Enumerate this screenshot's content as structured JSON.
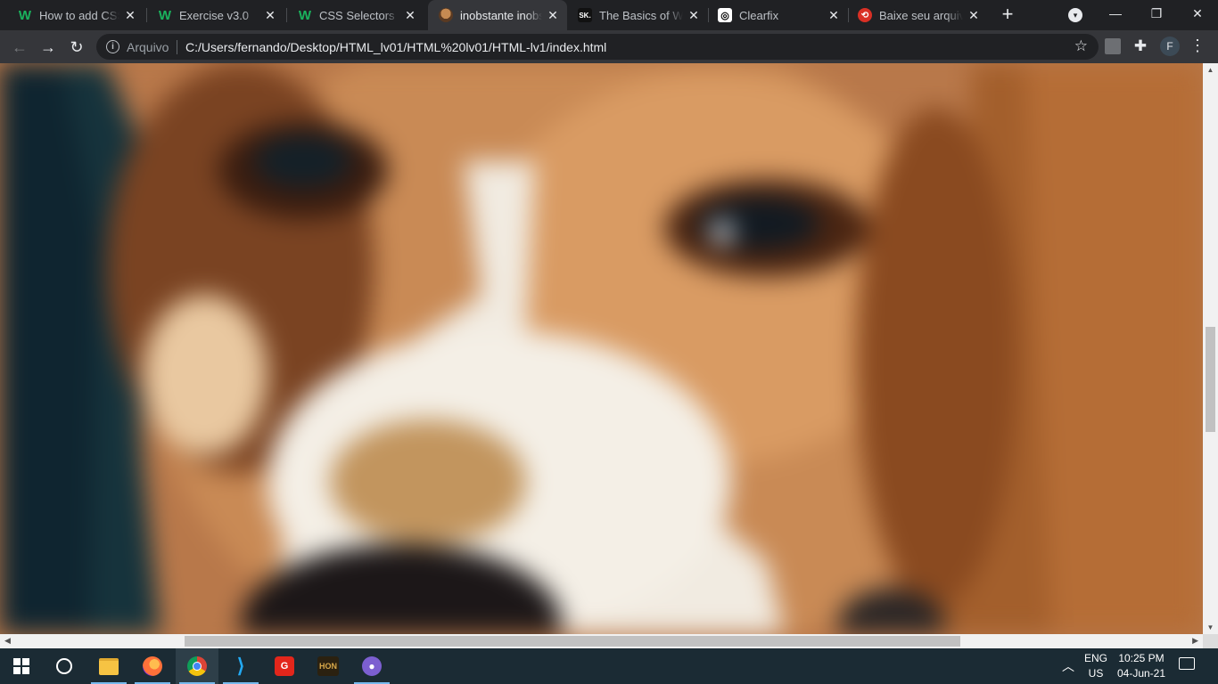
{
  "browser": {
    "tabs": [
      {
        "title": "How to add CSS",
        "favicon": "w3-icon",
        "glyph": "W",
        "active": false
      },
      {
        "title": "Exercise v3.0",
        "favicon": "w3-icon",
        "glyph": "W",
        "active": false
      },
      {
        "title": "CSS Selectors",
        "favicon": "w3-icon",
        "glyph": "W",
        "active": false
      },
      {
        "title": "inobstante inobstante",
        "favicon": "dog-photo-icon",
        "glyph": "",
        "active": true
      },
      {
        "title": "The Basics of Web",
        "favicon": "sk-icon",
        "glyph": "SK.",
        "active": false
      },
      {
        "title": "Clearfix",
        "favicon": "clearfix-icon",
        "glyph": "◎",
        "active": false
      },
      {
        "title": "Baixe seu arquivo",
        "favicon": "red-circle-icon",
        "glyph": "⟲",
        "active": false
      }
    ],
    "new_tab_glyph": "+",
    "tab_close_glyph": "✕",
    "window_controls": {
      "minimize": "—",
      "maximize": "❐",
      "close": "✕"
    },
    "toolbar": {
      "back_glyph": "←",
      "forward_glyph": "→",
      "reload_glyph": "↻",
      "scheme_label": "Arquivo",
      "url": "C:/Users/fernando/Desktop/HTML_lv01/HTML%20lv01/HTML-lv1/index.html",
      "bookmark_glyph": "☆",
      "profile_initial": "F",
      "menu_glyph": "⋮"
    }
  },
  "page": {
    "image_alt": "beagle dog close-up",
    "colors": {
      "fur_orange": "#c98a55",
      "fur_dark": "#7a4322",
      "white_muzzle": "#f4efe6",
      "background_teal": "#16333c"
    }
  },
  "taskbar": {
    "apps": [
      {
        "name": "start-button",
        "icon": "windows-icon"
      },
      {
        "name": "cortana-button",
        "icon": "circle-icon"
      },
      {
        "name": "file-explorer",
        "icon": "folder-icon"
      },
      {
        "name": "firefox",
        "icon": "firefox-icon"
      },
      {
        "name": "chrome",
        "icon": "chrome-icon"
      },
      {
        "name": "vscode",
        "icon": "vscode-icon"
      },
      {
        "name": "garena",
        "icon": "garena-icon"
      },
      {
        "name": "heroes-of-newerth",
        "icon": "hon-icon"
      },
      {
        "name": "github-desktop",
        "icon": "github-icon"
      }
    ],
    "hon_label": "HON",
    "lang_line1": "ENG",
    "lang_line2": "US",
    "time": "10:25 PM",
    "date": "04-Jun-21"
  }
}
